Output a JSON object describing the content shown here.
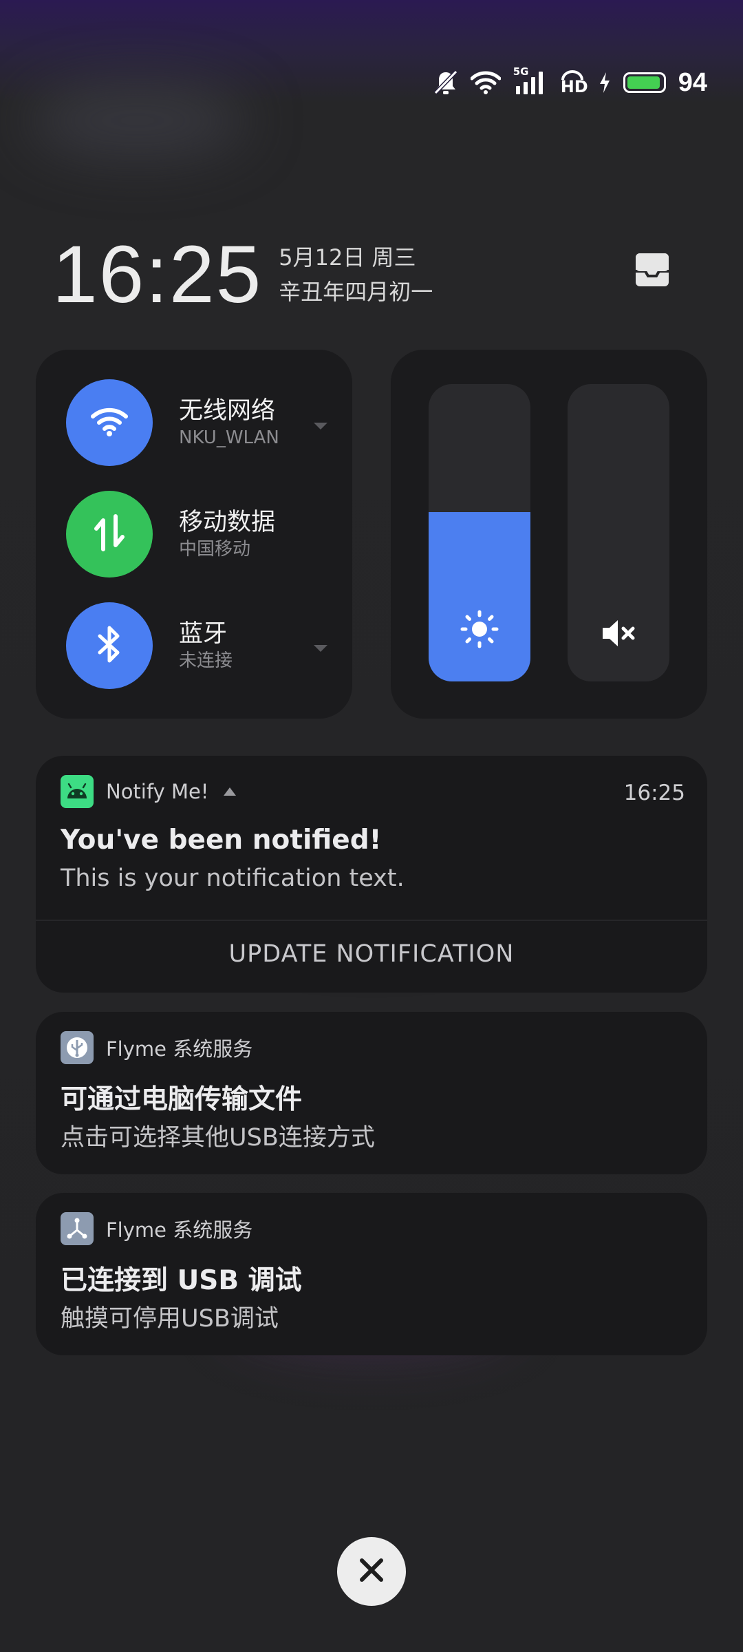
{
  "status_bar": {
    "network_label": "5G",
    "hd_label": "HD",
    "battery_level": 94,
    "battery_percent": "94",
    "battery_color": "#44d052"
  },
  "clock": {
    "time": "16:25",
    "date": "5月12日 周三",
    "lunar_date": "辛丑年四月初一"
  },
  "quick_toggles": [
    {
      "title": "无线网络",
      "subtitle": "NKU_WLAN",
      "icon": "wifi-icon",
      "color": "#4a7ef2",
      "has_dropdown": true
    },
    {
      "title": "移动数据",
      "subtitle": "中国移动",
      "icon": "mobile-data-icon",
      "color": "#34c25a",
      "has_dropdown": false
    },
    {
      "title": "蓝牙",
      "subtitle": "未连接",
      "icon": "bluetooth-icon",
      "color": "#4a7ef2",
      "has_dropdown": true
    }
  ],
  "sliders": {
    "brightness": {
      "level": 0.57,
      "icon": "sun-icon",
      "color": "#4c7ff0"
    },
    "volume": {
      "level": 0,
      "icon": "mute-icon"
    }
  },
  "notifications": [
    {
      "app_name": "Notify Me!",
      "time": "16:25",
      "title": "You've been notified!",
      "body": "This is your notification text.",
      "action": "UPDATE NOTIFICATION",
      "icon": "android-icon",
      "icon_color": "#3ddc84"
    },
    {
      "app_name": "Flyme 系统服务",
      "title": "可通过电脑传输文件",
      "body": "点击可选择其他USB连接方式",
      "icon": "usb-icon"
    },
    {
      "app_name": "Flyme 系统服务",
      "title": "已连接到 USB 调试",
      "body": "触摸可停用USB调试",
      "icon": "usb-debug-icon"
    }
  ],
  "close_button": {
    "icon": "close-icon"
  }
}
